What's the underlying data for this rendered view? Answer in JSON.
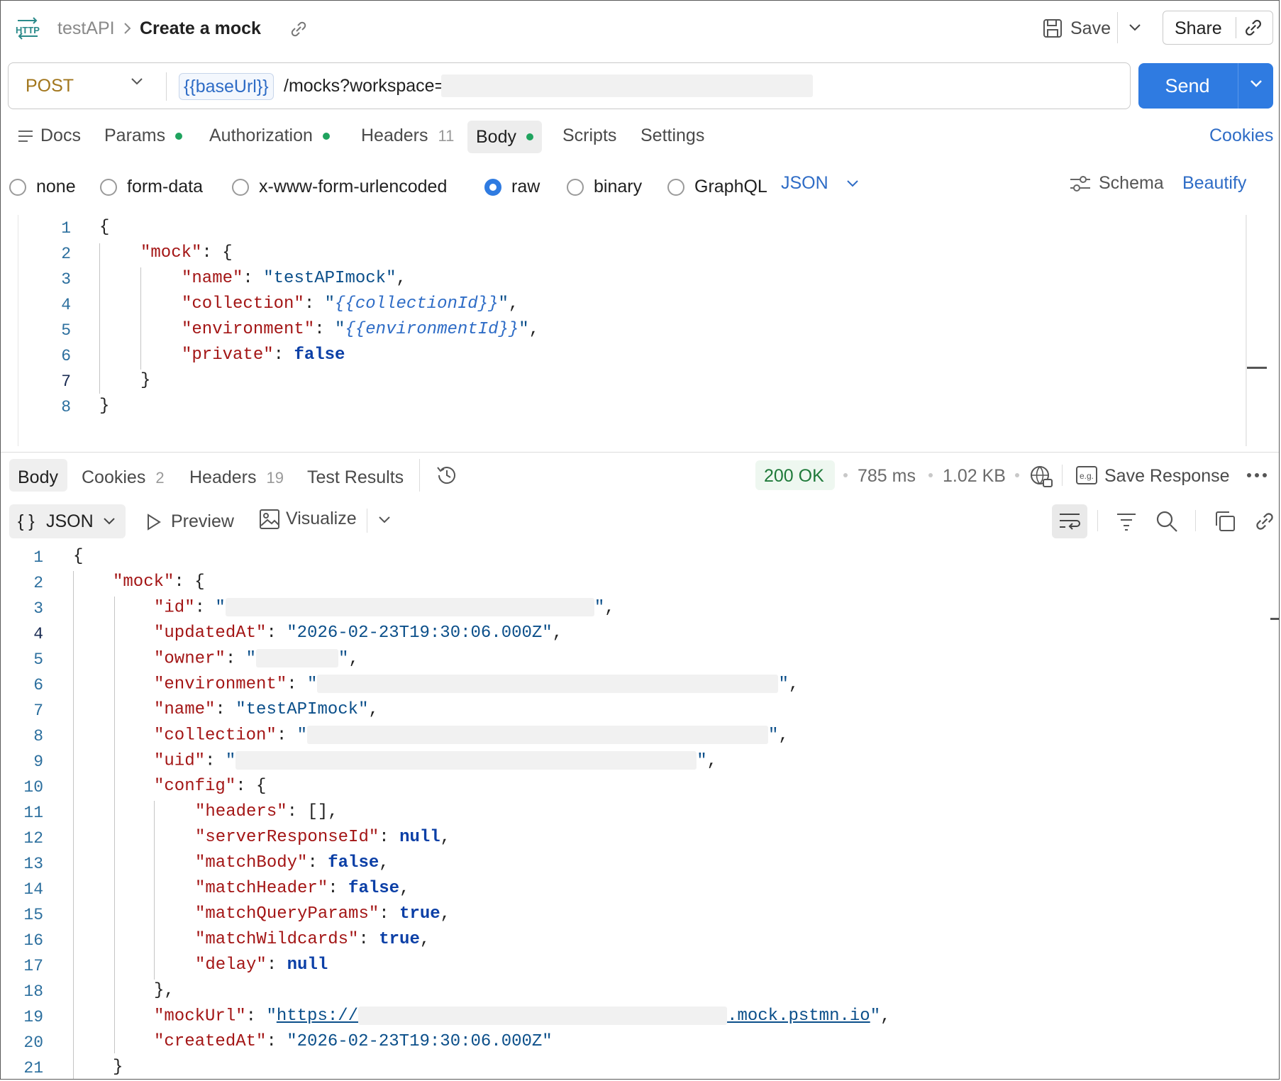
{
  "header": {
    "protocol_icon": "http-icon",
    "breadcrumb_parent": "testAPI",
    "breadcrumb_sep": ">",
    "title": "Create a mock",
    "save_label": "Save",
    "share_label": "Share"
  },
  "request": {
    "method": "POST",
    "url_variable": "{{baseUrl}}",
    "url_path": "/mocks?workspace=",
    "send_label": "Send"
  },
  "request_tabs": [
    {
      "label": "Docs"
    },
    {
      "label": "Params"
    },
    {
      "label": "Authorization"
    },
    {
      "label": "Headers",
      "count": "11"
    },
    {
      "label": "Body"
    },
    {
      "label": "Scripts"
    },
    {
      "label": "Settings"
    }
  ],
  "cookies_link": "Cookies",
  "body_types": [
    "none",
    "form-data",
    "x-www-form-urlencoded",
    "raw",
    "binary",
    "GraphQL"
  ],
  "selected_body_type": "raw",
  "body_format": "JSON",
  "schema_label": "Schema",
  "beautify_label": "Beautify",
  "request_body_lines": [
    "1",
    "2",
    "3",
    "4",
    "5",
    "6",
    "7",
    "8"
  ],
  "request_body": {
    "l1": "{",
    "l2_key": "\"mock\"",
    "l3_key": "\"name\"",
    "l3_val": "\"testAPImock\"",
    "l4_key": "\"collection\"",
    "l4_val": "{{collectionId}}",
    "l5_key": "\"environment\"",
    "l5_val": "{{environmentId}}",
    "l6_key": "\"private\"",
    "l6_val": "false",
    "l7": "}",
    "l8": "}"
  },
  "response_tabs": [
    {
      "label": "Body"
    },
    {
      "label": "Cookies",
      "count": "2"
    },
    {
      "label": "Headers",
      "count": "19"
    },
    {
      "label": "Test Results"
    }
  ],
  "response_meta": {
    "status": "200 OK",
    "time": "785 ms",
    "size": "1.02 KB",
    "save_response": "Save Response"
  },
  "response_view": {
    "format": "JSON",
    "preview": "Preview",
    "visualize": "Visualize"
  },
  "response_body": {
    "l1": "{",
    "l2_key": "\"mock\"",
    "l3_key": "\"id\"",
    "l4_key": "\"updatedAt\"",
    "l4_val": "\"2026-02-23T19:30:06.000Z\"",
    "l5_key": "\"owner\"",
    "l6_key": "\"environment\"",
    "l7_key": "\"name\"",
    "l7_val": "\"testAPImock\"",
    "l8_key": "\"collection\"",
    "l9_key": "\"uid\"",
    "l10_key": "\"config\"",
    "l11_key": "\"headers\"",
    "l11_val": "[]",
    "l12_key": "\"serverResponseId\"",
    "l12_val": "null",
    "l13_key": "\"matchBody\"",
    "l13_val": "false",
    "l14_key": "\"matchHeader\"",
    "l14_val": "false",
    "l15_key": "\"matchQueryParams\"",
    "l15_val": "true",
    "l16_key": "\"matchWildcards\"",
    "l16_val": "true",
    "l17_key": "\"delay\"",
    "l17_val": "null",
    "l18": "},",
    "l19_key": "\"mockUrl\"",
    "l19_prefix": "https://",
    "l19_suffix": ".mock.pstmn.io",
    "l20_key": "\"createdAt\"",
    "l20_val": "\"2026-02-23T19:30:06.000Z\"",
    "l21": "}"
  },
  "response_line_numbers": [
    "1",
    "2",
    "3",
    "4",
    "5",
    "6",
    "7",
    "8",
    "9",
    "10",
    "11",
    "12",
    "13",
    "14",
    "15",
    "16",
    "17",
    "18",
    "19",
    "20",
    "21"
  ]
}
